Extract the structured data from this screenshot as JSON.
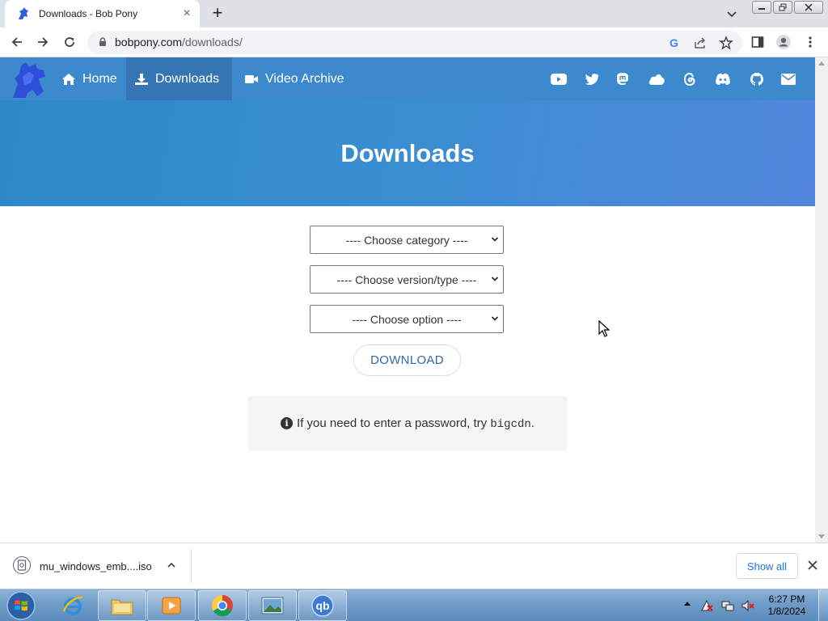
{
  "browser": {
    "tab_title": "Downloads - Bob Pony",
    "url_host": "bobpony.com",
    "url_path": "/downloads/"
  },
  "site": {
    "nav": [
      {
        "label": "Home",
        "icon": "home-icon"
      },
      {
        "label": "Downloads",
        "icon": "download-icon",
        "active": true
      },
      {
        "label": "Video Archive",
        "icon": "video-camera-icon"
      }
    ],
    "social_icons": [
      "youtube-icon",
      "twitter-icon",
      "mastodon-icon",
      "cloud-icon",
      "threads-icon",
      "discord-icon",
      "github-icon",
      "email-icon"
    ],
    "colors": {
      "nav": "#3d89ce",
      "nav_active": "#3575b4",
      "link": "#3366aa"
    }
  },
  "hero": {
    "title": "Downloads"
  },
  "form": {
    "category_placeholder": "---- Choose category ----",
    "version_placeholder": "---- Choose version/type ----",
    "option_placeholder": "---- Choose option ----",
    "download_button": "DOWNLOAD"
  },
  "notice": {
    "text": "If you need to enter a password, try",
    "code": "bigcdn",
    "trailing": "."
  },
  "downloads_bar": {
    "file_name": "mu_windows_emb....iso",
    "show_all": "Show all"
  },
  "taskbar": {
    "time": "6:27 PM",
    "date": "1/8/2024",
    "apps": [
      "internet-explorer-icon",
      "file-explorer-icon",
      "media-player-icon",
      "chrome-icon",
      "image-viewer-icon",
      "qbittorrent-icon"
    ],
    "qb_label": "qb"
  }
}
